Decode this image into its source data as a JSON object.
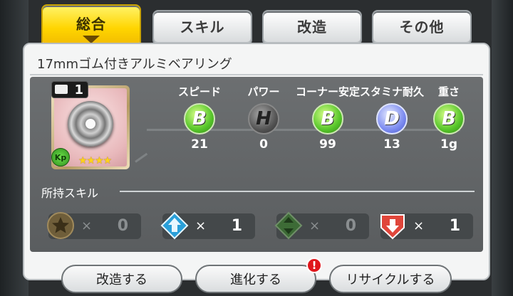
{
  "tabs": [
    {
      "label": "総合",
      "active": true
    },
    {
      "label": "スキル",
      "active": false
    },
    {
      "label": "改造",
      "active": false
    },
    {
      "label": "その他",
      "active": false
    }
  ],
  "item": {
    "name": "17mmゴム付きアルミベアリング",
    "count": "1",
    "badge": "Kp",
    "stars": "★★★★"
  },
  "stats": [
    {
      "label": "スピード",
      "grade": "B",
      "value": "21"
    },
    {
      "label": "パワー",
      "grade": "H",
      "value": "0"
    },
    {
      "label": "コーナー安定",
      "grade": "B",
      "value": "99"
    },
    {
      "label": "スタミナ耐久",
      "grade": "D",
      "value": "13"
    },
    {
      "label": "重さ",
      "grade": "B",
      "value": "1g"
    }
  ],
  "skills": {
    "label": "所持スキル",
    "items": [
      {
        "icon": "star-skill-icon",
        "x": "×",
        "count": "0"
      },
      {
        "icon": "up-arrow-skill-icon",
        "x": "×",
        "count": "1"
      },
      {
        "icon": "up-down-arrow-skill-icon",
        "x": "×",
        "count": "0"
      },
      {
        "icon": "down-arrow-skill-icon",
        "x": "×",
        "count": "1"
      }
    ]
  },
  "buttons": {
    "modify": "改造する",
    "evolve": "進化する",
    "recycle": "リサイクルする",
    "alert": "!"
  },
  "colors": {
    "tab_active": "#ffd500",
    "grade_B": "#57c62a",
    "grade_H": "#555555",
    "grade_D": "#7d8cf1",
    "alert": "#e0161b"
  }
}
